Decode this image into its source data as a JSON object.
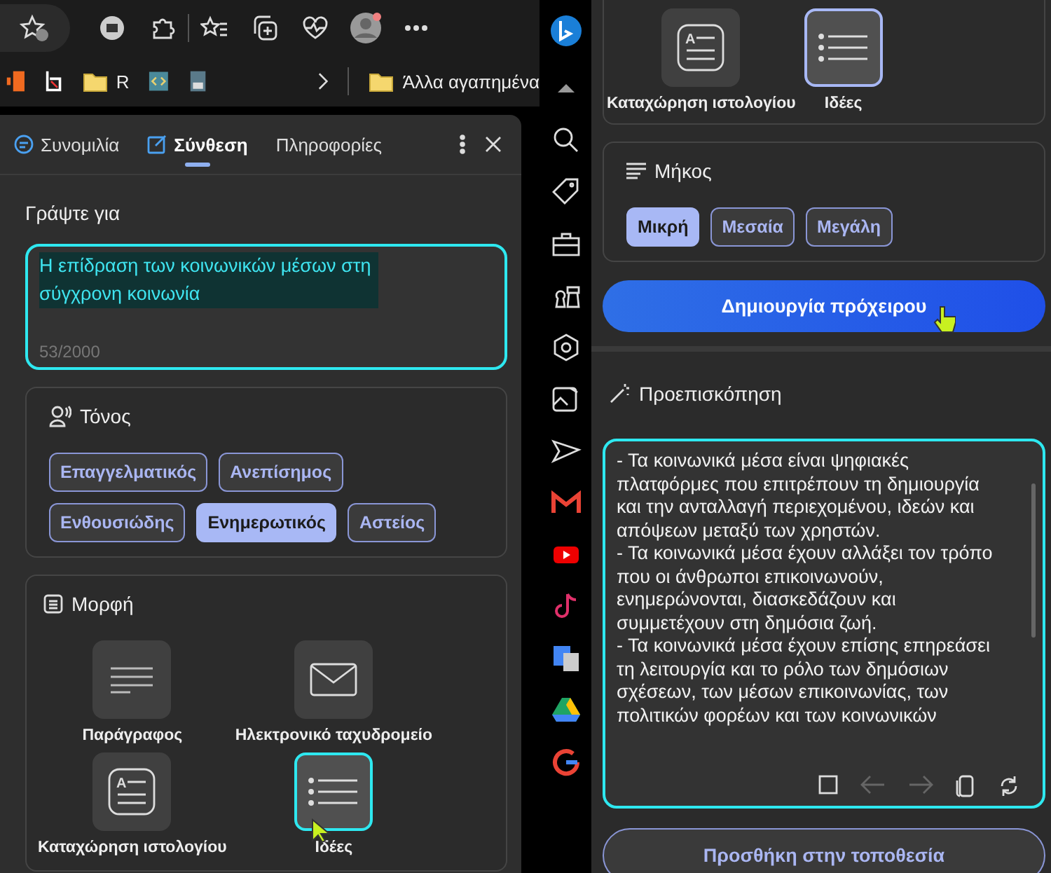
{
  "bookmarks": {
    "items": [
      {
        "label": "R"
      }
    ],
    "other_favorites": "Άλλα αγαπημένα"
  },
  "compose_panel": {
    "tabs": [
      {
        "label": "Συνομιλία",
        "selected": false
      },
      {
        "label": "Σύνθεση",
        "selected": true
      },
      {
        "label": "Πληροφορίες",
        "selected": false
      }
    ],
    "write_about": {
      "label": "Γράψτε για",
      "value": "Η επίδραση των κοινωνικών μέσων στη σύγχρονη κοινωνία",
      "counter": "53/2000"
    },
    "tone": {
      "title": "Τόνος",
      "options": [
        {
          "label": "Επαγγελματικός",
          "selected": false
        },
        {
          "label": "Ανεπίσημος",
          "selected": false
        },
        {
          "label": "Ενθουσιώδης",
          "selected": false
        },
        {
          "label": "Ενημερωτικός",
          "selected": true
        },
        {
          "label": "Αστείος",
          "selected": false
        }
      ]
    },
    "format": {
      "title": "Μορφή",
      "options": [
        {
          "kind": "paragraph",
          "label": "Παράγραφος",
          "selected": false
        },
        {
          "kind": "email",
          "label": "Ηλεκτρονικό ταχυδρομείο",
          "selected": false
        },
        {
          "kind": "blog",
          "icon_letter": "A",
          "label": "Καταχώρηση ιστολογίου",
          "selected": false
        },
        {
          "kind": "ideas",
          "label": "Ιδέες",
          "selected": true
        }
      ]
    }
  },
  "scrolled_panel": {
    "format_options": [
      {
        "kind": "blog",
        "icon_letter": "A",
        "label": "Καταχώρηση ιστολογίου",
        "selected": false
      },
      {
        "kind": "ideas",
        "label": "Ιδέες",
        "selected": true
      }
    ],
    "length": {
      "title": "Μήκος",
      "options": [
        {
          "label": "Μικρή",
          "selected": true
        },
        {
          "label": "Μεσαία",
          "selected": false
        },
        {
          "label": "Μεγάλη",
          "selected": false
        }
      ]
    },
    "generate_button": "Δημιουργία πρόχειρου",
    "preview": {
      "title": "Προεπισκόπηση",
      "paragraphs": [
        "- Τα κοινωνικά μέσα είναι ψηφιακές πλατφόρμες που επιτρέπουν τη δημιουργία και την ανταλλαγή περιεχομένου, ιδεών και απόψεων μεταξύ των χρηστών.",
        "- Τα κοινωνικά μέσα έχουν αλλάξει τον τρόπο που οι άνθρωποι επικοινωνούν, ενημερώνονται, διασκεδάζουν και συμμετέχουν στη δημόσια ζωή.",
        "- Τα κοινωνικά μέσα έχουν επίσης επηρεάσει τη λειτουργία και το ρόλο των δημόσιων σχέσεων, των μέσων επικοινωνίας, των πολιτικών φορέων και των κοινωνικών"
      ]
    },
    "add_button": "Προσθήκη στην τοποθεσία"
  }
}
